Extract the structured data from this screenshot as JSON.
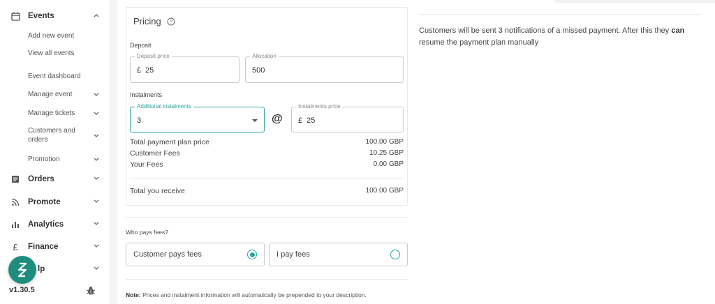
{
  "sidebar": {
    "events": {
      "label": "Events",
      "icon": "calendar-icon"
    },
    "events_sub": [
      "Add new event",
      "View all events"
    ],
    "event_dashboard": "Event dashboard",
    "manage_event": "Manage event",
    "manage_tickets": "Manage tickets",
    "customers_orders": "Customers and orders",
    "promotion": "Promotion",
    "orders": {
      "label": "Orders",
      "icon": "orders-icon"
    },
    "promote": {
      "label": "Promote",
      "icon": "rss-icon"
    },
    "analytics": {
      "label": "Analytics",
      "icon": "bar-chart-icon"
    },
    "finance": {
      "label": "Finance",
      "icon": "pound-icon"
    },
    "help": {
      "label": "lp",
      "icon": "help-icon"
    },
    "version": "v1.30.5"
  },
  "pricing": {
    "title": "Pricing",
    "deposit_label": "Deposit",
    "deposit_price_label": "Deposit price",
    "deposit_currency": "£",
    "deposit_price": "25",
    "allocation_label": "Allocation",
    "allocation": "500",
    "instalments_label": "Instalments",
    "additional_label": "Additional instalments",
    "additional_value": "3",
    "at_symbol": "@",
    "instalments_price_label": "Instalments price",
    "instalments_currency": "£",
    "instalments_price": "25",
    "summary": [
      {
        "label": "Total payment plan price",
        "value": "100.00 GBP"
      },
      {
        "label": "Customer Fees",
        "value": "10.25 GBP"
      },
      {
        "label": "Your Fees",
        "value": "0.00 GBP"
      }
    ],
    "total_label": "Total you receive",
    "total_value": "100.00 GBP"
  },
  "fees": {
    "question": "Who pays fees?",
    "customer_option": "Customer pays fees",
    "self_option": "I pay fees",
    "selected": "customer"
  },
  "note": {
    "prefix": "Note:",
    "text": " Prices and instalment information will automatically be prepended to your description."
  },
  "info": {
    "text_before": "Customers will be sent 3 notifications of a missed payment. After this they ",
    "text_bold": "can",
    "text_after": " resume the payment plan manually"
  },
  "colors": {
    "accent": "#2aa5a0",
    "brand": "#1f8d7e"
  }
}
